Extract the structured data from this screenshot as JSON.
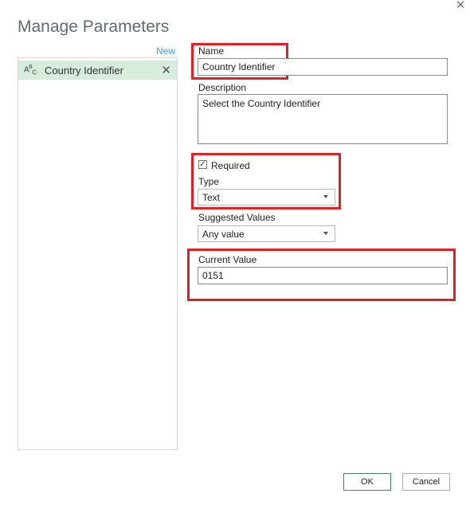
{
  "dialog": {
    "title": "Manage Parameters",
    "close_glyph": "✕"
  },
  "list": {
    "new_label": "New",
    "items": [
      {
        "type_icon": "ABC",
        "label": "Country Identifier",
        "remove_glyph": "✕",
        "selected": true
      }
    ]
  },
  "form": {
    "name_label": "Name",
    "name_value": "Country Identifier",
    "description_label": "Description",
    "description_value": "Select the Country Identifier",
    "required_label": "Required",
    "required_checked": true,
    "type_label": "Type",
    "type_value": "Text",
    "suggested_label": "Suggested Values",
    "suggested_value": "Any value",
    "current_label": "Current Value",
    "current_value": "0151"
  },
  "buttons": {
    "ok": "OK",
    "cancel": "Cancel"
  },
  "colors": {
    "highlight_box": "#e02024",
    "selected_item_bg": "#d6ecdc",
    "link": "#3fa1d8"
  }
}
